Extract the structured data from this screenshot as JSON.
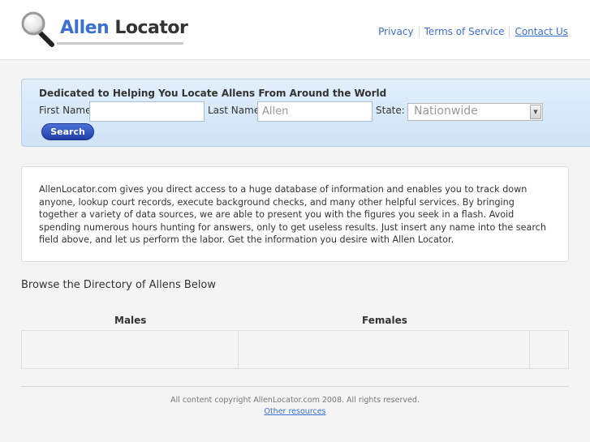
{
  "header": {
    "logo_main": "Allen",
    "logo_suffix": " Locator",
    "nav": [
      "Privacy",
      "Terms of Service",
      "Contact Us"
    ]
  },
  "search": {
    "title": "Dedicated to Helping You Locate Allens From Around the World",
    "first_name_label": "First Name",
    "first_name_value": "",
    "last_name_label": "Last Name",
    "last_name_value": "Allen",
    "state_label": "State:",
    "state_value": "Nationwide",
    "button_label": "Search"
  },
  "description": "AllenLocator.com gives you direct access to a huge database of information and enables you to track down anyone, lookup court records, execute background checks, and many other helpful services. By bringing together a variety of data sources, we are able to present you with the figures you seek in a flash. Avoid spending numerous hours hunting for answers, only to get useless results. Just insert any name into the search field above, and let us perform the labor. Get the information you desire with Allen Locator.",
  "directory": {
    "heading": "Browse the Directory of Allens Below",
    "columns": [
      "Males",
      "Females"
    ]
  },
  "footer": {
    "copyright": "All content copyright AllenLocator.com 2008. All rights reserved.",
    "link": "Other resources"
  },
  "colors": {
    "accent": "#3b6fd4",
    "button": "#2a4bbd"
  }
}
